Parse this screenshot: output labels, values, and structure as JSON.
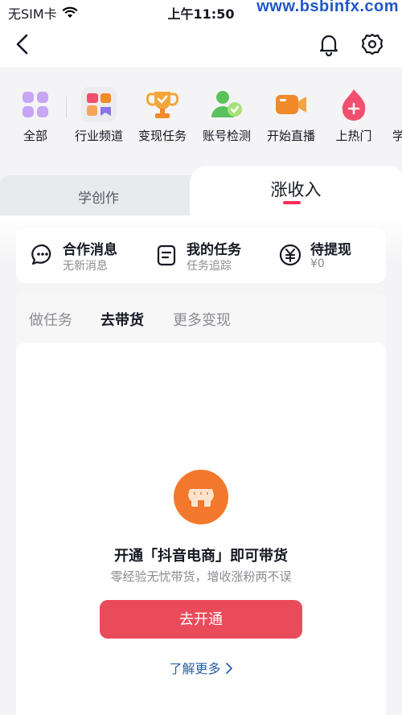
{
  "status_bar": {
    "carrier": "无SIM卡",
    "time": "上午11:50",
    "watermark": "www.bsbinfx.com"
  },
  "nav": {
    "back_icon": "chevron-left-icon",
    "bell_icon": "bell-icon",
    "settings_icon": "gear-icon"
  },
  "shortcuts": [
    {
      "label": "全部",
      "icon": "grid-icon"
    },
    {
      "label": "行业频道",
      "icon": "channel-icon"
    },
    {
      "label": "变现任务",
      "icon": "trophy-icon"
    },
    {
      "label": "账号检测",
      "icon": "user-check-icon"
    },
    {
      "label": "开始直播",
      "icon": "video-camera-icon"
    },
    {
      "label": "上热门",
      "icon": "flame-plus-icon"
    },
    {
      "label": "学"
    }
  ],
  "big_tabs": {
    "left": "学创作",
    "right": "涨收入"
  },
  "info": {
    "coop": {
      "title": "合作消息",
      "sub": "无新消息",
      "icon": "chat-icon"
    },
    "tasks": {
      "title": "我的任务",
      "sub": "任务追踪",
      "icon": "clipboard-icon"
    },
    "withdraw": {
      "title": "待提现",
      "sub": "¥0",
      "icon": "yen-icon"
    }
  },
  "sub_tabs": [
    "做任务",
    "去带货",
    "更多变现"
  ],
  "empty": {
    "icon": "shop-icon",
    "title": "开通「抖音电商」即可带货",
    "subtitle": "零经验无忧带货，增收涨粉两不误",
    "button": "去开通",
    "link": "了解更多"
  },
  "colors": {
    "accent": "#fe2c55",
    "button": "#ea4b5a",
    "link": "#2a5fae",
    "shop_icon": "#f2792c"
  }
}
